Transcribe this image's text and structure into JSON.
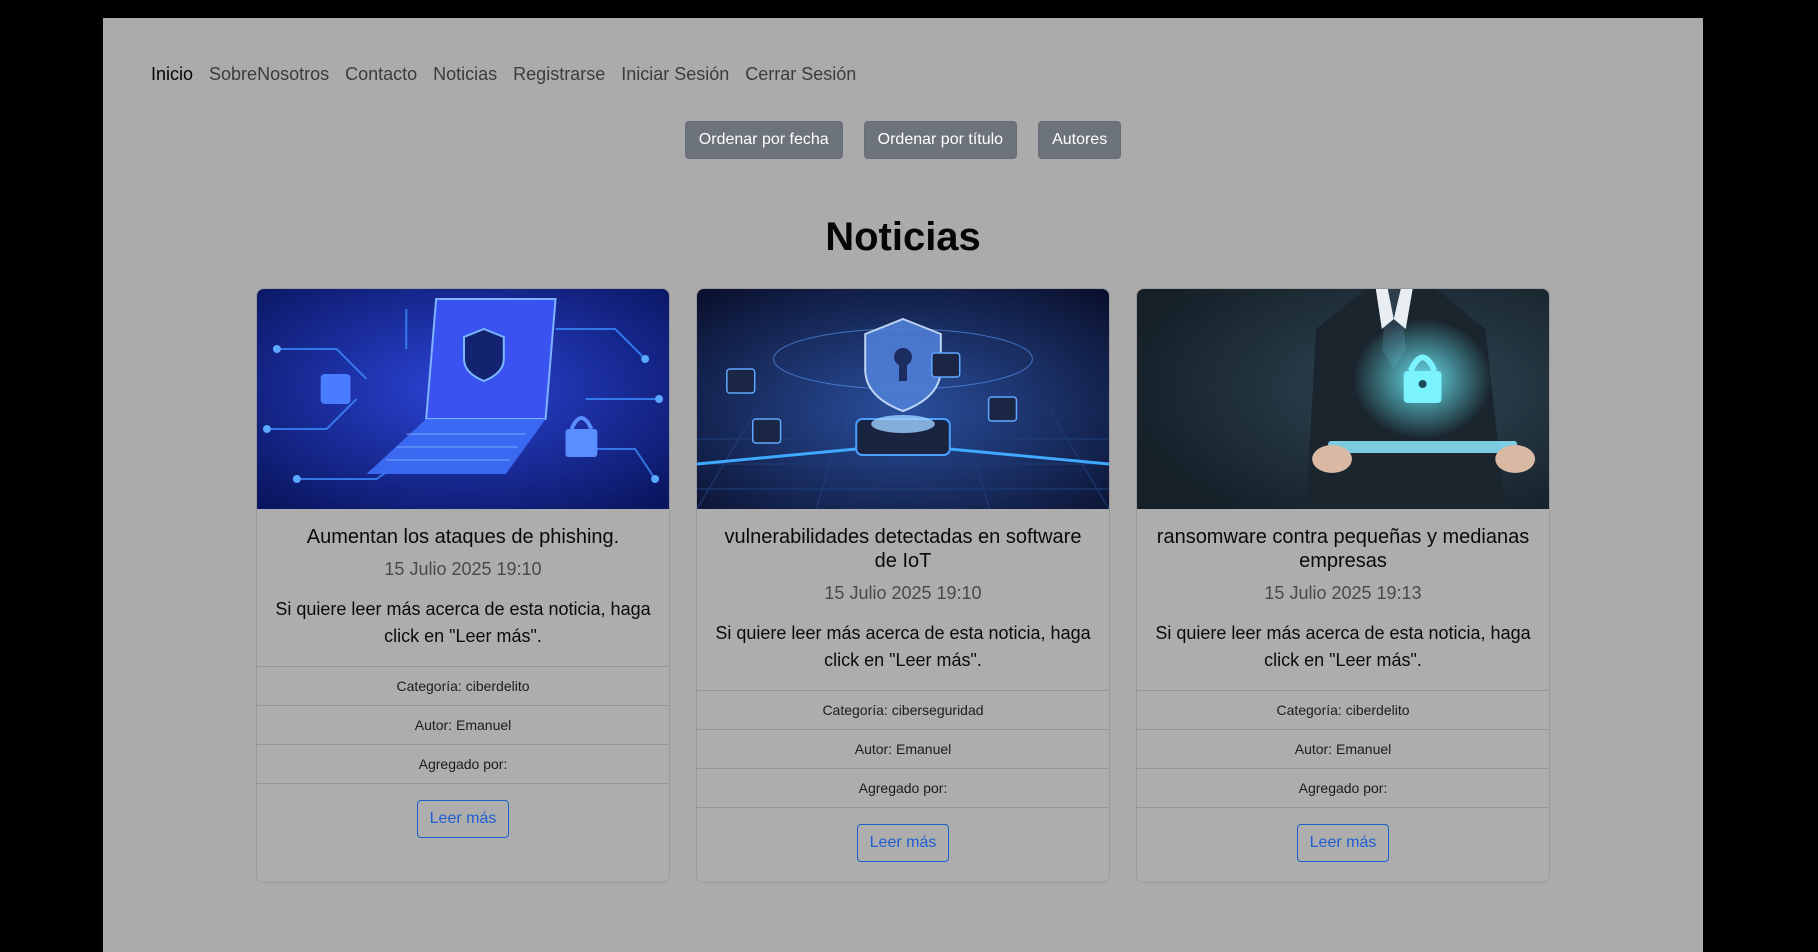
{
  "nav": {
    "items": [
      {
        "label": "Inicio"
      },
      {
        "label": "SobreNosotros"
      },
      {
        "label": "Contacto"
      },
      {
        "label": "Noticias"
      },
      {
        "label": "Registrarse"
      },
      {
        "label": "Iniciar Sesión"
      },
      {
        "label": "Cerrar Sesión"
      }
    ]
  },
  "sort": {
    "by_date": "Ordenar por fecha",
    "by_title": "Ordenar por título",
    "authors": "Autores"
  },
  "page": {
    "title": "Noticias"
  },
  "news": [
    {
      "image_icon": "laptop-circuit-icon",
      "title": "Aumentan los ataques de phishing.",
      "date": "15 Julio 2025 19:10",
      "text": "Si quiere leer más acerca de esta noticia, haga click en \"Leer más\".",
      "category": "Categoría: ciberdelito",
      "author": "Autor: Emanuel",
      "added_by": "Agregado por:",
      "read_more": "Leer más"
    },
    {
      "image_icon": "shield-chip-icon",
      "title": "vulnerabilidades detectadas en software de IoT",
      "date": "15 Julio 2025 19:10",
      "text": "Si quiere leer más acerca de esta noticia, haga click en \"Leer más\".",
      "category": "Categoría: ciberseguridad",
      "author": "Autor: Emanuel",
      "added_by": "Agregado por:",
      "read_more": "Leer más"
    },
    {
      "image_icon": "businessman-lock-icon",
      "title": "ransomware contra pequeñas y medianas empresas",
      "date": "15 Julio 2025 19:13",
      "text": "Si quiere leer más acerca de esta noticia, haga click en \"Leer más\".",
      "category": "Categoría: ciberdelito",
      "author": "Autor: Emanuel",
      "added_by": "Agregado por:",
      "read_more": "Leer más"
    }
  ],
  "colors": {
    "backdrop": "#000000",
    "page_bg": "#ababab",
    "sort_button": "#6d737a",
    "link_blue": "#1f5fd0"
  }
}
